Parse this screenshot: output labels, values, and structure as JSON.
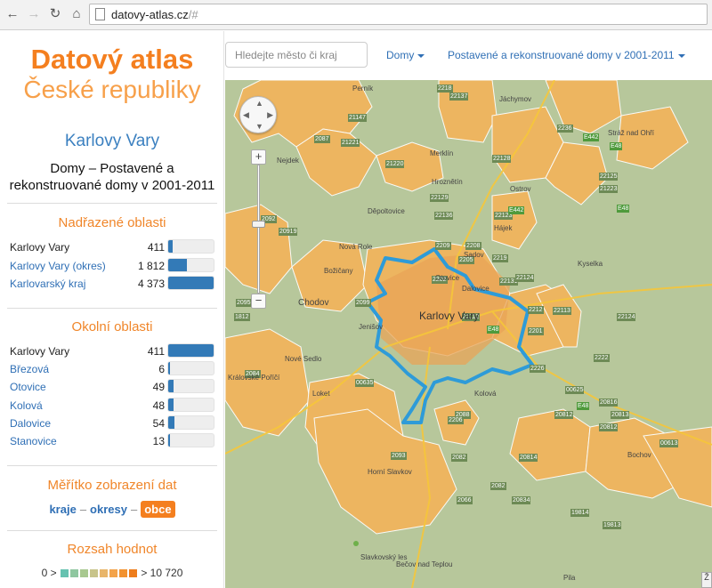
{
  "browser": {
    "url_host": "datovy-atlas.cz",
    "url_rest": "/#"
  },
  "sidebar": {
    "brand_line1": "Datový atlas",
    "brand_line2": "České republiky",
    "place": "Karlovy Vary",
    "dataset_line1": "Domy – Postavené a",
    "dataset_line2": "rekonstruované domy v 2001-2011",
    "parent_title": "Nadřazené oblasti",
    "parent": [
      {
        "name": "Karlovy Vary",
        "value": "411",
        "fraction": 0.09
      },
      {
        "name": "Karlovy Vary (okres)",
        "value": "1 812",
        "fraction": 0.41
      },
      {
        "name": "Karlovarský kraj",
        "value": "4 373",
        "fraction": 1.0
      }
    ],
    "nearby_title": "Okolní oblasti",
    "nearby": [
      {
        "name": "Karlovy Vary",
        "value": "411",
        "fraction": 1.0
      },
      {
        "name": "Březová",
        "value": "6",
        "fraction": 0.015
      },
      {
        "name": "Otovice",
        "value": "49",
        "fraction": 0.12
      },
      {
        "name": "Kolová",
        "value": "48",
        "fraction": 0.12
      },
      {
        "name": "Dalovice",
        "value": "54",
        "fraction": 0.13
      },
      {
        "name": "Stanovice",
        "value": "13",
        "fraction": 0.03
      }
    ],
    "scale_title": "Měřítko zobrazení dat",
    "scale": {
      "kraje": "kraje",
      "okresy": "okresy",
      "obce": "obce",
      "dash": "–"
    },
    "range_title": "Rozsah hodnot",
    "range_min": "0 >",
    "range_max": "> 10 720",
    "range_colors": [
      "#66c2b0",
      "#8fc7a0",
      "#a8c88f",
      "#c8c48a",
      "#e8b56a",
      "#f3a34a",
      "#f2922f",
      "#ee7d1c"
    ]
  },
  "topbar": {
    "search_placeholder": "Hledejte město či kraj",
    "menu1": "Domy",
    "menu2": "Postavené a rekonstruované domy v 2001-2011"
  },
  "map": {
    "center_label": "Karlovy Vary",
    "place_labels": [
      "Perník",
      "Jáchymov",
      "Nejdek",
      "Merklín",
      "Hroznětín",
      "Ostrov",
      "Děpoltovice",
      "Hájek",
      "Sadov",
      "Nová Role",
      "Otovice",
      "Božičany",
      "Dalovice",
      "Chodov",
      "Jenišov",
      "Nové Sedlo",
      "Kolová",
      "Loket",
      "Královské Poříčí",
      "Horní Slavkov",
      "Bečov nad Teplou",
      "Bochov",
      "Kyselka",
      "Stráž nad Ohří",
      "Slavkovský les",
      "Pila"
    ],
    "road_tags": [
      "21147",
      "22137",
      "2218",
      "2236",
      "21221",
      "21220",
      "22129",
      "22136",
      "22128",
      "22123",
      "2209",
      "2219",
      "22131",
      "2202",
      "2205",
      "22124",
      "2212",
      "22113",
      "2201",
      "2226",
      "2092",
      "2087",
      "20919",
      "2095",
      "2084",
      "2099",
      "20814",
      "20812",
      "20813",
      "2082",
      "2088",
      "2093",
      "2066",
      "2206",
      "21112",
      "20812",
      "00613",
      "00625",
      "20816",
      "21223",
      "22125",
      "22124",
      "19814",
      "19813",
      "20834",
      "2082",
      "00635",
      "2208",
      "2222",
      "1812"
    ],
    "green_tags": [
      "E442",
      "E442",
      "E48",
      "E48",
      "E48",
      "E48"
    ],
    "corner_label": "Ž"
  }
}
